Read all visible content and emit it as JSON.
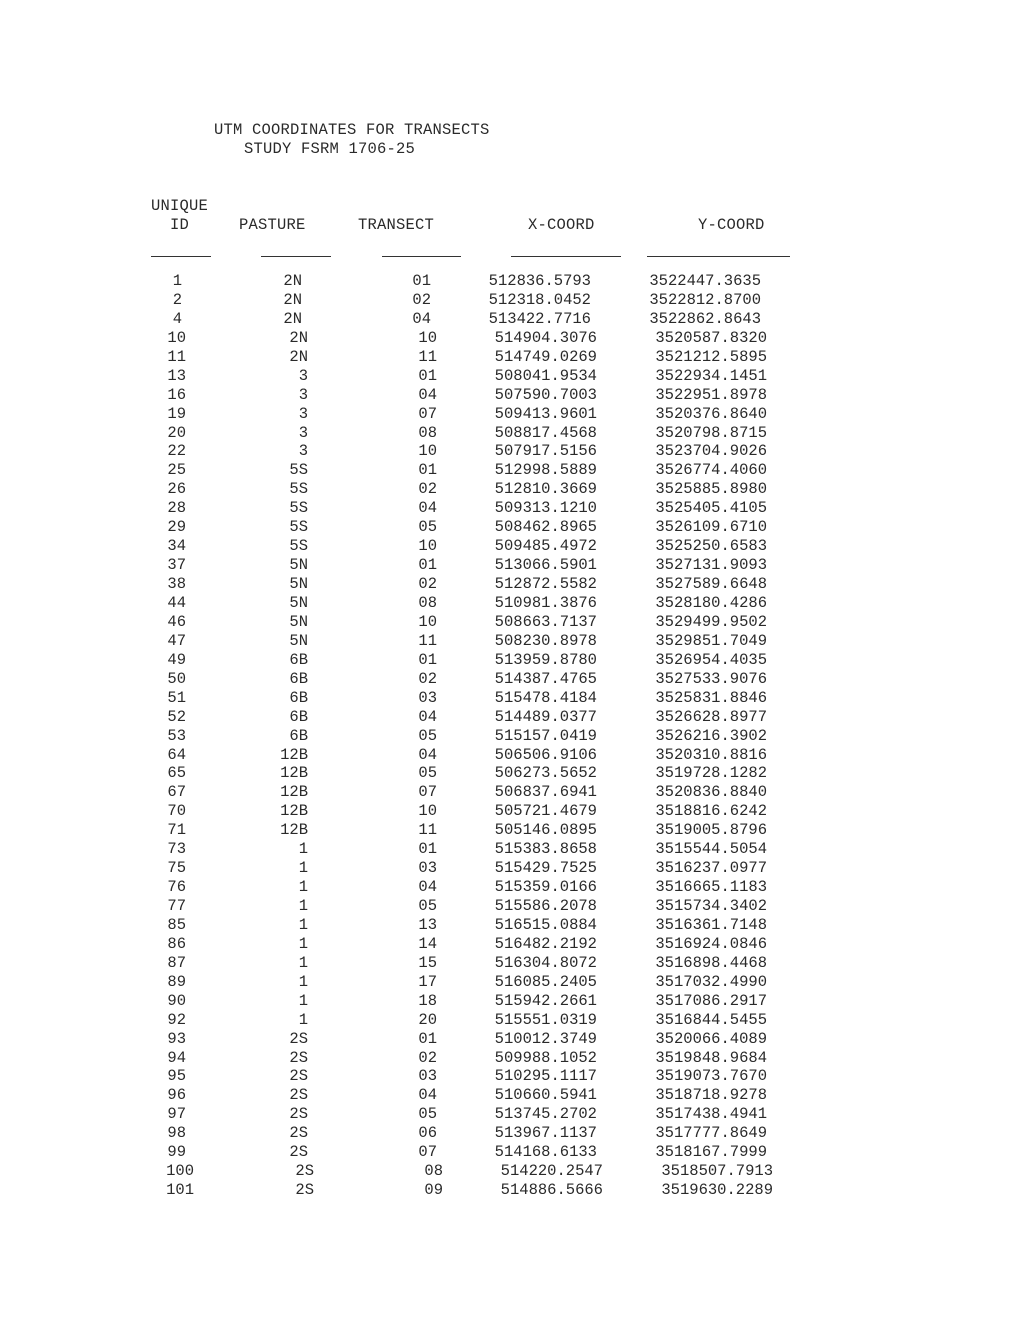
{
  "document": {
    "title": "UTM COORDINATES FOR TRANSECTS",
    "subtitle": "STUDY FSRM 1706-25"
  },
  "table": {
    "headers": {
      "id_line1": "UNIQUE",
      "id_line2": "ID",
      "pasture": "PASTURE",
      "transect": "TRANSECT",
      "x_coord": "X-COORD",
      "y_coord": "Y-COORD"
    },
    "rows": [
      {
        "id": "1",
        "pasture": "2N",
        "transect": "01",
        "x": "512836.5793",
        "y": "3522447.3635"
      },
      {
        "id": "2",
        "pasture": "2N",
        "transect": "02",
        "x": "512318.0452",
        "y": "3522812.8700"
      },
      {
        "id": "4",
        "pasture": "2N",
        "transect": "04",
        "x": "513422.7716",
        "y": "3522862.8643"
      },
      {
        "id": "10",
        "pasture": "2N",
        "transect": "10",
        "x": "514904.3076",
        "y": "3520587.8320"
      },
      {
        "id": "11",
        "pasture": "2N",
        "transect": "11",
        "x": "514749.0269",
        "y": "3521212.5895"
      },
      {
        "id": "13",
        "pasture": "3",
        "transect": "01",
        "x": "508041.9534",
        "y": "3522934.1451"
      },
      {
        "id": "16",
        "pasture": "3",
        "transect": "04",
        "x": "507590.7003",
        "y": "3522951.8978"
      },
      {
        "id": "19",
        "pasture": "3",
        "transect": "07",
        "x": "509413.9601",
        "y": "3520376.8640"
      },
      {
        "id": "20",
        "pasture": "3",
        "transect": "08",
        "x": "508817.4568",
        "y": "3520798.8715"
      },
      {
        "id": "22",
        "pasture": "3",
        "transect": "10",
        "x": "507917.5156",
        "y": "3523704.9026"
      },
      {
        "id": "25",
        "pasture": "5S",
        "transect": "01",
        "x": "512998.5889",
        "y": "3526774.4060"
      },
      {
        "id": "26",
        "pasture": "5S",
        "transect": "02",
        "x": "512810.3669",
        "y": "3525885.8980"
      },
      {
        "id": "28",
        "pasture": "5S",
        "transect": "04",
        "x": "509313.1210",
        "y": "3525405.4105"
      },
      {
        "id": "29",
        "pasture": "5S",
        "transect": "05",
        "x": "508462.8965",
        "y": "3526109.6710"
      },
      {
        "id": "34",
        "pasture": "5S",
        "transect": "10",
        "x": "509485.4972",
        "y": "3525250.6583"
      },
      {
        "id": "37",
        "pasture": "5N",
        "transect": "01",
        "x": "513066.5901",
        "y": "3527131.9093"
      },
      {
        "id": "38",
        "pasture": "5N",
        "transect": "02",
        "x": "512872.5582",
        "y": "3527589.6648"
      },
      {
        "id": "44",
        "pasture": "5N",
        "transect": "08",
        "x": "510981.3876",
        "y": "3528180.4286"
      },
      {
        "id": "46",
        "pasture": "5N",
        "transect": "10",
        "x": "508663.7137",
        "y": "3529499.9502"
      },
      {
        "id": "47",
        "pasture": "5N",
        "transect": "11",
        "x": "508230.8978",
        "y": "3529851.7049"
      },
      {
        "id": "49",
        "pasture": "6B",
        "transect": "01",
        "x": "513959.8780",
        "y": "3526954.4035"
      },
      {
        "id": "50",
        "pasture": "6B",
        "transect": "02",
        "x": "514387.4765",
        "y": "3527533.9076"
      },
      {
        "id": "51",
        "pasture": "6B",
        "transect": "03",
        "x": "515478.4184",
        "y": "3525831.8846"
      },
      {
        "id": "52",
        "pasture": "6B",
        "transect": "04",
        "x": "514489.0377",
        "y": "3526628.8977"
      },
      {
        "id": "53",
        "pasture": "6B",
        "transect": "05",
        "x": "515157.0419",
        "y": "3526216.3902"
      },
      {
        "id": "64",
        "pasture": "12B",
        "transect": "04",
        "x": "506506.9106",
        "y": "3520310.8816"
      },
      {
        "id": "65",
        "pasture": "12B",
        "transect": "05",
        "x": "506273.5652",
        "y": "3519728.1282"
      },
      {
        "id": "67",
        "pasture": "12B",
        "transect": "07",
        "x": "506837.6941",
        "y": "3520836.8840"
      },
      {
        "id": "70",
        "pasture": "12B",
        "transect": "10",
        "x": "505721.4679",
        "y": "3518816.6242"
      },
      {
        "id": "71",
        "pasture": "12B",
        "transect": "11",
        "x": "505146.0895",
        "y": "3519005.8796"
      },
      {
        "id": "73",
        "pasture": "1",
        "transect": "01",
        "x": "515383.8658",
        "y": "3515544.5054"
      },
      {
        "id": "75",
        "pasture": "1",
        "transect": "03",
        "x": "515429.7525",
        "y": "3516237.0977"
      },
      {
        "id": "76",
        "pasture": "1",
        "transect": "04",
        "x": "515359.0166",
        "y": "3516665.1183"
      },
      {
        "id": "77",
        "pasture": "1",
        "transect": "05",
        "x": "515586.2078",
        "y": "3515734.3402"
      },
      {
        "id": "85",
        "pasture": "1",
        "transect": "13",
        "x": "516515.0884",
        "y": "3516361.7148"
      },
      {
        "id": "86",
        "pasture": "1",
        "transect": "14",
        "x": "516482.2192",
        "y": "3516924.0846"
      },
      {
        "id": "87",
        "pasture": "1",
        "transect": "15",
        "x": "516304.8072",
        "y": "3516898.4468"
      },
      {
        "id": "89",
        "pasture": "1",
        "transect": "17",
        "x": "516085.2405",
        "y": "3517032.4990"
      },
      {
        "id": "90",
        "pasture": "1",
        "transect": "18",
        "x": "515942.2661",
        "y": "3517086.2917"
      },
      {
        "id": "92",
        "pasture": "1",
        "transect": "20",
        "x": "515551.0319",
        "y": "3516844.5455"
      },
      {
        "id": "93",
        "pasture": "2S",
        "transect": "01",
        "x": "510012.3749",
        "y": "3520066.4089"
      },
      {
        "id": "94",
        "pasture": "2S",
        "transect": "02",
        "x": "509988.1052",
        "y": "3519848.9684"
      },
      {
        "id": "95",
        "pasture": "2S",
        "transect": "03",
        "x": "510295.1117",
        "y": "3519073.7670"
      },
      {
        "id": "96",
        "pasture": "2S",
        "transect": "04",
        "x": "510660.5941",
        "y": "3518718.9278"
      },
      {
        "id": "97",
        "pasture": "2S",
        "transect": "05",
        "x": "513745.2702",
        "y": "3517438.4941"
      },
      {
        "id": "98",
        "pasture": "2S",
        "transect": "06",
        "x": "513967.1137",
        "y": "3517777.8649"
      },
      {
        "id": "99",
        "pasture": "2S",
        "transect": "07",
        "x": "514168.6133",
        "y": "3518167.7999"
      },
      {
        "id": "100",
        "pasture": "2S",
        "transect": "08",
        "x": "514220.2547",
        "y": "3518507.7913"
      },
      {
        "id": "101",
        "pasture": "2S",
        "transect": "09",
        "x": "514886.5666",
        "y": "3519630.2289"
      }
    ]
  }
}
